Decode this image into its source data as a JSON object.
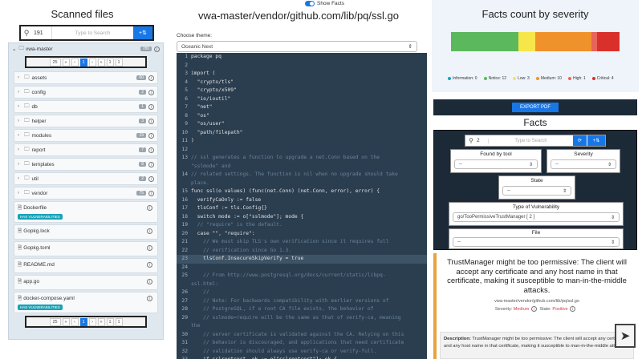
{
  "left": {
    "title": "Scanned files",
    "search": {
      "count": "191",
      "placeholder": "Type to Search"
    },
    "root": {
      "name": "vwa-master",
      "badge": "780"
    },
    "pager_top": {
      "per_page": "25",
      "current": "1",
      "next": "1",
      "last": "1"
    },
    "folders": [
      {
        "name": "assets",
        "badge": "60"
      },
      {
        "name": "config",
        "badge": "2"
      },
      {
        "name": "db",
        "badge": "1"
      },
      {
        "name": "helper",
        "badge": "3"
      },
      {
        "name": "modules",
        "badge": "19"
      },
      {
        "name": "report",
        "badge": "7"
      },
      {
        "name": "templates",
        "badge": "8"
      },
      {
        "name": "util",
        "badge": "2"
      },
      {
        "name": "vendor",
        "badge": "75"
      }
    ],
    "files": [
      {
        "name": "Dockerfile",
        "tag": "HAS VULNERABILITIES"
      },
      {
        "name": "Gopkg.lock"
      },
      {
        "name": "Gopkg.toml"
      },
      {
        "name": "README.md"
      },
      {
        "name": "app.go"
      },
      {
        "name": "docker-compose.yaml",
        "tag": "HAS VULNERABILITIES"
      }
    ],
    "pager_bottom": {
      "per_page": "25",
      "current": "1",
      "next": "1",
      "last": "1"
    }
  },
  "mid": {
    "title": "vwa-master/vendor/github.com/lib/pq/ssl.go",
    "toggle_label": "Show Facts",
    "theme_label": "Choose theme:",
    "theme_value": "Oceanic Next",
    "code": [
      {
        "n": "1",
        "t": "package pq"
      },
      {
        "n": "2",
        "t": ""
      },
      {
        "n": "3",
        "t": "import ("
      },
      {
        "n": "4",
        "t": "  \"crypto/tls\""
      },
      {
        "n": "5",
        "t": "  \"crypto/x509\""
      },
      {
        "n": "6",
        "t": "  \"io/ioutil\""
      },
      {
        "n": "7",
        "t": "  \"net\""
      },
      {
        "n": "8",
        "t": "  \"os\""
      },
      {
        "n": "9",
        "t": "  \"os/user\""
      },
      {
        "n": "10",
        "t": "  \"path/filepath\""
      },
      {
        "n": "11",
        "t": ")"
      },
      {
        "n": "12",
        "t": ""
      },
      {
        "n": "13",
        "t": "// ssl generates a function to upgrade a net.Conn based on the",
        "c": true
      },
      {
        "n": "",
        "t": "\"sslmode\" and",
        "c": true
      },
      {
        "n": "14",
        "t": "// related settings. The function is nil when no upgrade should take",
        "c": true
      },
      {
        "n": "",
        "t": "place.",
        "c": true
      },
      {
        "n": "15",
        "t": "func ssl(o values) (func(net.Conn) (net.Conn, error), error) {"
      },
      {
        "n": "16",
        "t": "  verifyCaOnly := false"
      },
      {
        "n": "17",
        "t": "  tlsConf := tls.Config{}"
      },
      {
        "n": "18",
        "t": "  switch mode := o[\"sslmode\"]; mode {"
      },
      {
        "n": "19",
        "t": "  // \"require\" is the default.",
        "c": true
      },
      {
        "n": "20",
        "t": "  case \"\", \"require\":"
      },
      {
        "n": "21",
        "t": "    // We must skip TLS's own verification since it requires full",
        "c": true
      },
      {
        "n": "22",
        "t": "    // verification since Go 1.3.",
        "c": true
      },
      {
        "n": "23",
        "t": "    tlsConf.InsecureSkipVerify = true",
        "h": true
      },
      {
        "n": "24",
        "t": ""
      },
      {
        "n": "25",
        "t": "    // From http://www.postgresql.org/docs/current/static/libpq-",
        "c": true
      },
      {
        "n": "",
        "t": "ssl.html:",
        "c": true
      },
      {
        "n": "26",
        "t": "    //",
        "c": true
      },
      {
        "n": "27",
        "t": "    // Note: For backwards compatibility with earlier versions of",
        "c": true
      },
      {
        "n": "28",
        "t": "    // PostgreSQL, if a root CA file exists, the behavior of",
        "c": true
      },
      {
        "n": "29",
        "t": "    // sslmode=require will be the same as that of verify-ca, meaning",
        "c": true
      },
      {
        "n": "",
        "t": "the",
        "c": true
      },
      {
        "n": "30",
        "t": "    // server certificate is validated against the CA. Relying on this",
        "c": true
      },
      {
        "n": "31",
        "t": "    // behavior is discouraged, and applications that need certificate",
        "c": true
      },
      {
        "n": "32",
        "t": "    // validation should always use verify-ca or verify-full.",
        "c": true
      },
      {
        "n": "33",
        "t": "    if sslrootcert, ok := o[\"sslrootcert\"]; ok {"
      }
    ]
  },
  "right": {
    "chart_title": "Facts count by severity",
    "chart_data": {
      "type": "bar",
      "categories": [
        "Information",
        "Notice",
        "Low",
        "Medium",
        "High",
        "Critical"
      ],
      "values": [
        0,
        12,
        3,
        10,
        1,
        4
      ],
      "colors": [
        "#17a2b8",
        "#5cb85c",
        "#f7e64a",
        "#f0922b",
        "#e8645a",
        "#d9302b"
      ]
    },
    "legend": [
      {
        "label": "Information: 0",
        "color": "#17a2b8"
      },
      {
        "label": "Notice: 12",
        "color": "#5cb85c"
      },
      {
        "label": "Low: 3",
        "color": "#f7e64a"
      },
      {
        "label": "Medium: 10",
        "color": "#f0922b"
      },
      {
        "label": "High: 1",
        "color": "#e8645a"
      },
      {
        "label": "Critical: 4",
        "color": "#d9302b"
      }
    ],
    "export_label": "EXPORT PDF",
    "facts_title": "Facts",
    "facts_search": {
      "count": "2",
      "placeholder": "Type to Search"
    },
    "filters": {
      "found_by_tool": {
        "label": "Found by tool",
        "value": "--"
      },
      "severity": {
        "label": "Severity",
        "value": "--"
      },
      "state": {
        "label": "State",
        "value": "--"
      },
      "type": {
        "label": "Type of Vulnerability",
        "value": "go/TooPermissiveTrustManager [ 2 ]"
      },
      "file": {
        "label": "File",
        "value": "--"
      }
    },
    "card": {
      "title": "TrustManager might be too permissive: The client will accept any certificate and any host name in that certificate, making it susceptible to man-in-the-middle attacks.",
      "path": "vwa-master/vendor/github.com/lib/pq/ssl.go",
      "severity_label": "Severity:",
      "severity_value": "Medium",
      "state_label": "State:",
      "state_value": "Positive",
      "desc_label": "Description:",
      "desc_text": "TrustManager might be too permissive: The client will accept any certificate and any host name in that certificate, making it susceptible to man-in-the-middle attacks."
    }
  }
}
